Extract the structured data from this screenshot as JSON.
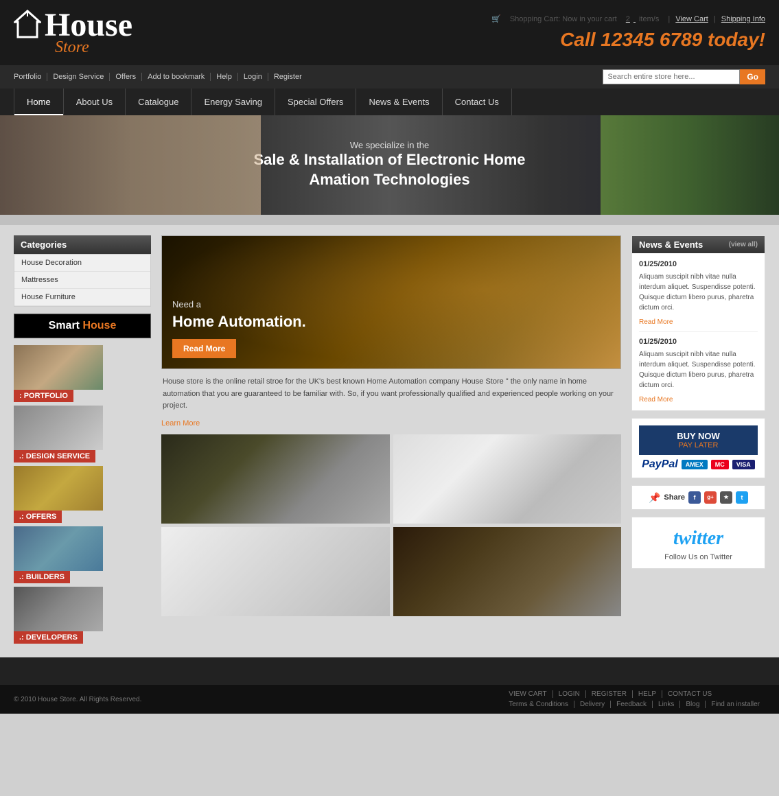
{
  "header": {
    "logo_main": "House",
    "logo_sub": "Store",
    "cart_text": "Shopping Cart: Now in your cart",
    "cart_count": "2",
    "cart_unit": "item/s",
    "view_cart": "View Cart",
    "separator": "|",
    "shipping": "Shipping Info",
    "phone": "Call 12345 6789 today!"
  },
  "topnav": {
    "links": [
      "Portfolio",
      "Design Service",
      "Offers",
      "Add to bookmark",
      "Help",
      "Login",
      "Register"
    ],
    "search_placeholder": "Search entire store here...",
    "search_btn": "Go"
  },
  "mainnav": {
    "items": [
      "Home",
      "About Us",
      "Catalogue",
      "Energy Saving",
      "Special Offers",
      "News & Events",
      "Contact Us"
    ]
  },
  "banner": {
    "line1": "We specialize in the",
    "line2": "Sale & Installation of Electronic Home",
    "line3": "Amation Technologies"
  },
  "sidebar": {
    "cat_header": "Categories",
    "categories": [
      "House Decoration",
      "Mattresses",
      "House Furniture"
    ],
    "smart_house": "Smart House",
    "items": [
      {
        "label": ": PORTFOLIO",
        "img_class": "sidebar-img-portfolio"
      },
      {
        "label": ".: DESIGN SERVICE",
        "img_class": "sidebar-img-design"
      },
      {
        "label": ".: OFFERS",
        "img_class": "sidebar-img-offers"
      },
      {
        "label": ".: BUILDERS",
        "img_class": "sidebar-img-builders"
      },
      {
        "label": ".: DEVELOPERS",
        "img_class": "sidebar-img-developers"
      }
    ]
  },
  "hero": {
    "need_a": "Need a",
    "title": "Home Automation.",
    "read_more_btn": "Read More"
  },
  "description": {
    "text": "House store is the online retail stroe for the UK's best known Home Automation company House Store \" the only name in home automation that you are guaranteed to be familiar with. So, if you want professionally qualified and experienced people working on your project.",
    "learn_more": "Learn More"
  },
  "news": {
    "header": "News & Events",
    "view_all": "(view all)",
    "items": [
      {
        "date": "01/25/2010",
        "body": "Aliquam suscipit nibh vitae nulla interdum aliquet. Suspendisse potenti. Quisque dictum libero purus, pharetra dictum orci.",
        "read_more": "Read More"
      },
      {
        "date": "01/25/2010",
        "body": "Aliquam suscipit nibh vitae nulla interdum aliquet. Suspendisse potenti. Quisque dictum libero purus, pharetra dictum orci.",
        "read_more": "Read More"
      }
    ]
  },
  "paypal": {
    "buy_now": "BUY NOW",
    "pay_later": "PAY LATER",
    "paypal": "PayPal",
    "amex": "AMEX",
    "mc": "MC",
    "visa": "VISA"
  },
  "share": {
    "label": "Share",
    "icons": [
      "f",
      "g+",
      "yt",
      "t"
    ]
  },
  "twitter": {
    "logo": "twitter",
    "follow": "Follow Us on Twitter"
  },
  "footer": {
    "copy": "© 2010 House Store. All Rights Reserved.",
    "top_links": [
      "VIEW CART",
      "LOGIN",
      "REGISTER",
      "HELP",
      "CONTACT US"
    ],
    "bottom_links": [
      "Terms & Conditions",
      "Delivery",
      "Feedback",
      "Links",
      "Blog",
      "Find an installer"
    ]
  }
}
